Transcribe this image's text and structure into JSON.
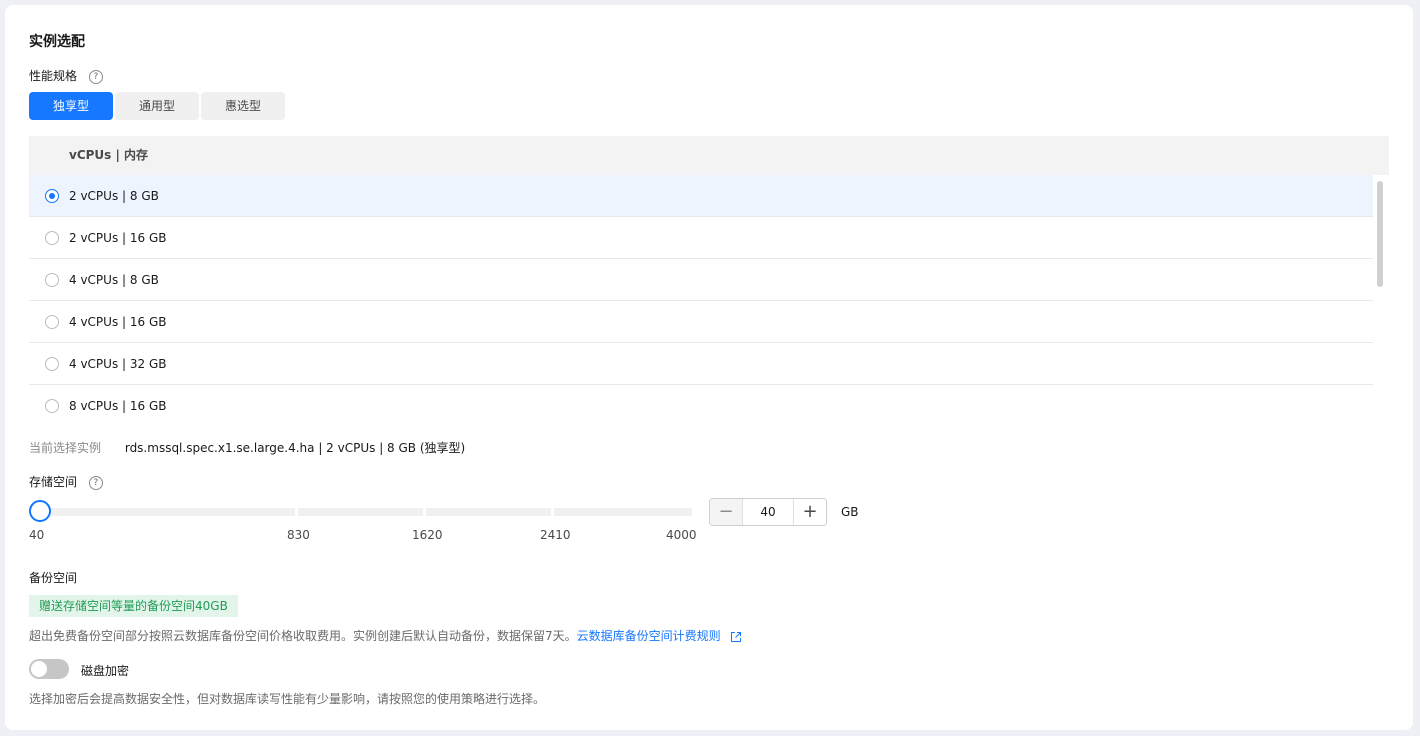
{
  "section_title": "实例选配",
  "perf": {
    "label": "性能规格",
    "help": "?",
    "tabs": [
      {
        "label": "独享型",
        "active": true
      },
      {
        "label": "通用型",
        "active": false
      },
      {
        "label": "惠选型",
        "active": false
      }
    ],
    "table_header": "vCPUs | 内存",
    "rows": [
      {
        "label": "2 vCPUs | 8 GB",
        "selected": true
      },
      {
        "label": "2 vCPUs | 16 GB",
        "selected": false
      },
      {
        "label": "4 vCPUs | 8 GB",
        "selected": false
      },
      {
        "label": "4 vCPUs | 16 GB",
        "selected": false
      },
      {
        "label": "4 vCPUs | 32 GB",
        "selected": false
      },
      {
        "label": "8 vCPUs | 16 GB",
        "selected": false
      }
    ]
  },
  "current": {
    "label": "当前选择实例",
    "value": "rds.mssql.spec.x1.se.large.4.ha | 2 vCPUs | 8 GB (独享型)"
  },
  "storage": {
    "label": "存储空间",
    "help": "?",
    "ticks": [
      "40",
      "830",
      "1620",
      "2410",
      "4000"
    ],
    "value": "40",
    "minus": "−",
    "plus": "+",
    "unit": "GB"
  },
  "backup": {
    "label": "备份空间",
    "badge": "赠送存储空间等量的备份空间40GB",
    "note": "超出免费备份空间部分按照云数据库备份空间价格收取费用。实例创建后默认自动备份，数据保留7天。",
    "link": "云数据库备份空间计费规则"
  },
  "encrypt": {
    "label": "磁盘加密",
    "enabled": false,
    "note": "选择加密后会提高数据安全性，但对数据库读写性能有少量影响，请按照您的使用策略进行选择。"
  },
  "colors": {
    "accent": "#1677ff",
    "badge_bg": "#e3f5ea",
    "badge_text": "#1f9d55"
  }
}
